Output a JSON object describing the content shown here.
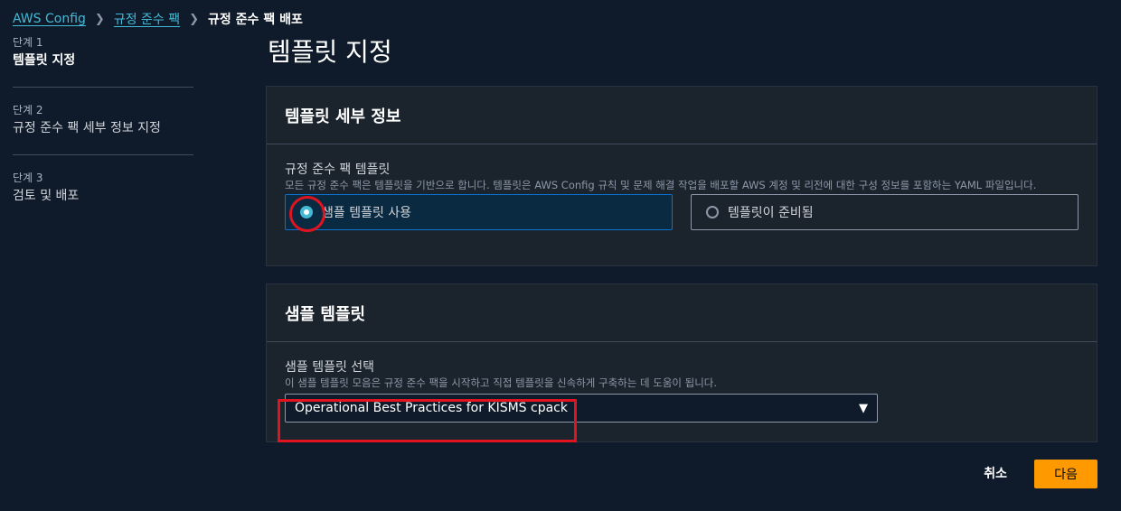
{
  "breadcrumb": {
    "items": [
      "AWS Config",
      "규정 준수 팩"
    ],
    "current": "규정 준수 팩 배포"
  },
  "steps": [
    {
      "num": "단계 1",
      "title": "템플릿 지정"
    },
    {
      "num": "단계 2",
      "title": "규정 준수 팩 세부 정보 지정"
    },
    {
      "num": "단계 3",
      "title": "검토 및 배포"
    }
  ],
  "page_title": "템플릿 지정",
  "template_details": {
    "header": "템플릿 세부 정보",
    "field_label": "규정 준수 팩 템플릿",
    "field_desc": "모든 규정 준수 팩은 템플릿을 기반으로 합니다. 템플릿은 AWS Config 규칙 및 문제 해결 작업을 배포할 AWS 계정 및 리전에 대한 구성 정보를 포함하는 YAML 파일입니다.",
    "options": [
      {
        "label": "샘플 템플릿 사용",
        "selected": true
      },
      {
        "label": "템플릿이 준비됨",
        "selected": false
      }
    ]
  },
  "sample_template": {
    "header": "샘플 템플릿",
    "field_label": "샘플 템플릿 선택",
    "field_desc": "이 샘플 템플릿 모음은 규정 준수 팩을 시작하고 직접 템플릿을 신속하게 구축하는 데 도움이 됩니다.",
    "selected_value": "Operational Best Practices for KISMS cpack"
  },
  "actions": {
    "cancel": "취소",
    "next": "다음"
  },
  "colors": {
    "accent": "#44b9d6",
    "primary_button": "#ff9900",
    "annotation": "#e0141e"
  }
}
